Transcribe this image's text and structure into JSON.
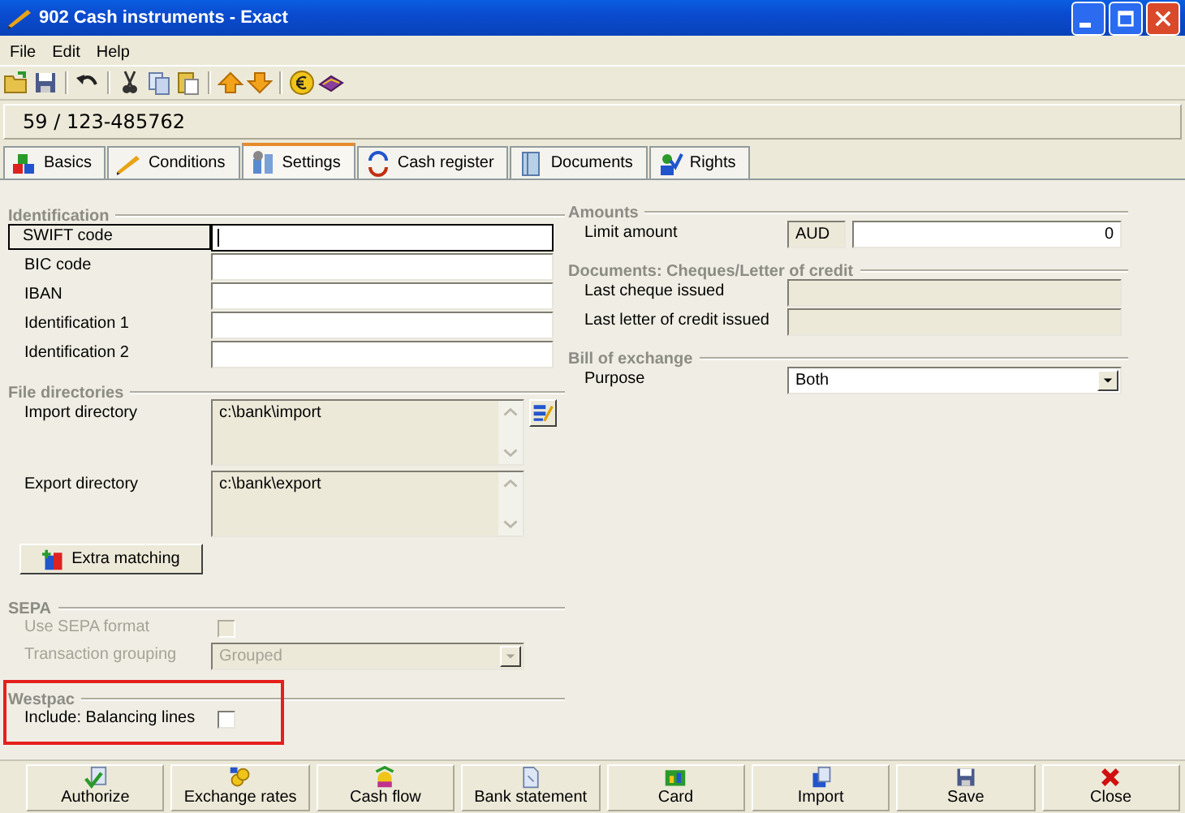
{
  "window": {
    "title": "902 Cash instruments - Exact"
  },
  "menu": [
    "File",
    "Edit",
    "Help"
  ],
  "account": "59 / 123-485762",
  "tabs": [
    {
      "label": "Basics",
      "selected": false
    },
    {
      "label": "Conditions",
      "selected": false
    },
    {
      "label": "Settings",
      "selected": true
    },
    {
      "label": "Cash register",
      "selected": false
    },
    {
      "label": "Documents",
      "selected": false
    },
    {
      "label": "Rights",
      "selected": false
    }
  ],
  "left_sections": [
    {
      "title": "Identification",
      "highlighted": false,
      "fields": [
        {
          "kind": "text",
          "label": "SWIFT code",
          "focused": true,
          "disabled": false
        },
        {
          "kind": "text",
          "label": "BIC code",
          "focused": false,
          "disabled": false
        },
        {
          "kind": "text",
          "label": "IBAN",
          "focused": false,
          "disabled": false
        },
        {
          "kind": "text",
          "label": "Identification 1",
          "focused": false,
          "disabled": false
        },
        {
          "kind": "text",
          "label": "Identification 2",
          "focused": false,
          "disabled": false
        }
      ]
    },
    {
      "title": "File directories",
      "highlighted": false,
      "fields": [
        {
          "kind": "textarea",
          "label": "Import directory",
          "value": "c:\\bank\\import",
          "browse_button": true
        },
        {
          "kind": "textarea",
          "label": "Export directory",
          "value": "c:\\bank\\export",
          "browse_button": false
        },
        {
          "kind": "button",
          "label": "Extra matching"
        }
      ]
    },
    {
      "title": "SEPA",
      "highlighted": false,
      "fields": [
        {
          "kind": "checkbox",
          "label": "Use SEPA format",
          "checked": false,
          "disabled": true
        },
        {
          "kind": "select",
          "label": "Transaction grouping",
          "value": "Grouped",
          "disabled": true
        }
      ]
    },
    {
      "title": "Westpac",
      "highlighted": true,
      "fields": [
        {
          "kind": "checkbox",
          "label": "Include: Balancing lines",
          "checked": false,
          "disabled": false
        }
      ]
    }
  ],
  "right_sections": [
    {
      "title": "Amounts",
      "highlighted": false,
      "fields": [
        {
          "kind": "amount",
          "label": "Limit amount",
          "currency": "AUD",
          "value": "0"
        }
      ]
    },
    {
      "title": "Documents: Cheques/Letter of credit",
      "highlighted": false,
      "fields": [
        {
          "kind": "text",
          "label": "Last cheque issued",
          "focused": false,
          "disabled": true
        },
        {
          "kind": "text",
          "label": "Last letter of credit issued",
          "focused": false,
          "disabled": true
        }
      ]
    },
    {
      "title": "Bill of exchange",
      "highlighted": false,
      "fields": [
        {
          "kind": "select",
          "label": "Purpose",
          "value": "Both",
          "disabled": false
        }
      ]
    }
  ],
  "buttons": [
    "Authorize",
    "Exchange rates",
    "Cash flow",
    "Bank statement",
    "Card",
    "Import",
    "Save",
    "Close"
  ]
}
